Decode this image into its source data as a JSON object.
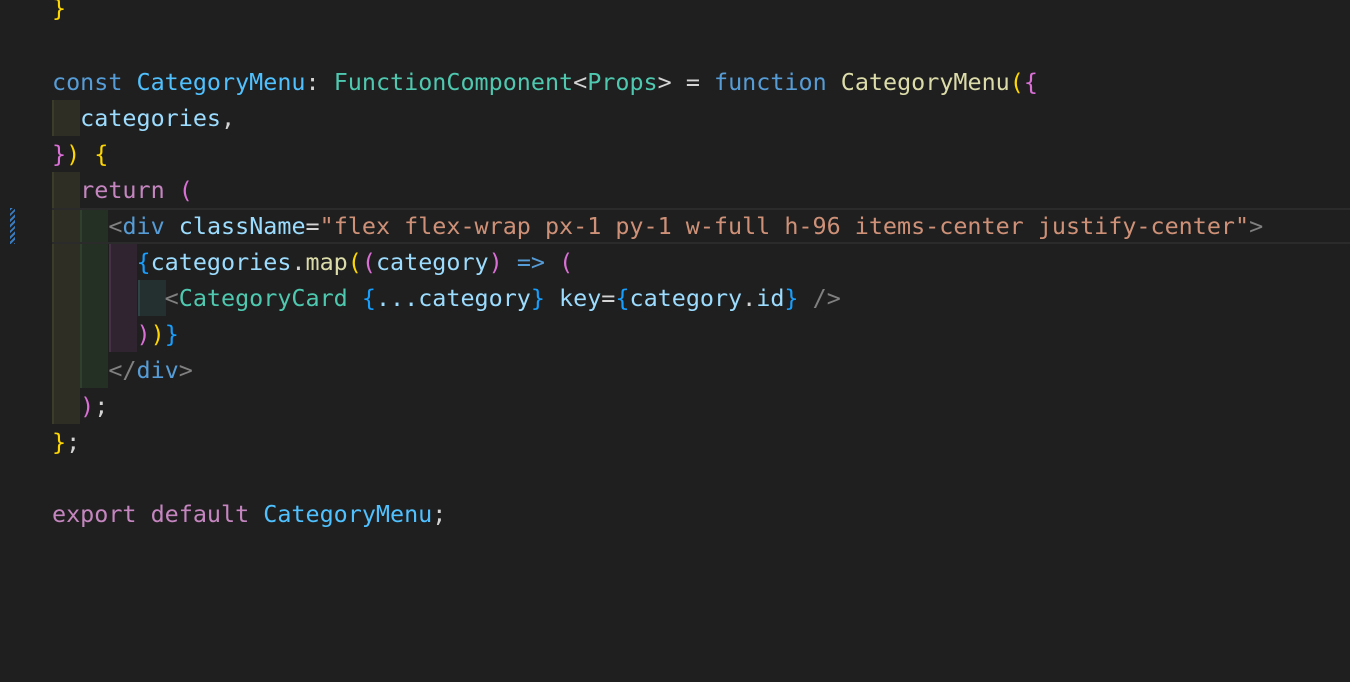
{
  "code": {
    "line0": {
      "brace": "}"
    },
    "line2": {
      "const_kw": "const",
      "name": "CategoryMenu",
      "colon": ":",
      "type": "FunctionComponent",
      "lt": "<",
      "props": "Props",
      "gt": ">",
      "eq": "=",
      "function_kw": "function",
      "fn_name": "CategoryMenu",
      "paren": "(",
      "brace": "{"
    },
    "line3": {
      "param": "categories",
      "comma": ","
    },
    "line4": {
      "brace_close": "}",
      "paren_close": ")",
      "brace_open": "{"
    },
    "line5": {
      "return_kw": "return",
      "paren": "("
    },
    "line6": {
      "lt": "<",
      "tag": "div",
      "attr": "className",
      "eq": "=",
      "value": "\"flex flex-wrap px-1 py-1 w-full h-96 items-center justify-center\"",
      "gt": ">"
    },
    "line7": {
      "brace": "{",
      "obj": "categories",
      "dot": ".",
      "method": "map",
      "paren1": "(",
      "paren2": "(",
      "arg": "category",
      "paren3": ")",
      "arrow": "=>",
      "paren4": "("
    },
    "line8": {
      "lt": "<",
      "component": "CategoryCard",
      "spread_open": "{",
      "spread": "...category",
      "spread_close": "}",
      "key_attr": "key",
      "eq": "=",
      "key_open": "{",
      "key_obj": "category",
      "key_dot": ".",
      "key_prop": "id",
      "key_close": "}",
      "self_close": "/>"
    },
    "line9": {
      "p1": ")",
      "p2": ")",
      "brace": "}"
    },
    "line10": {
      "open": "</",
      "tag": "div",
      "gt": ">"
    },
    "line11": {
      "paren": ")",
      "semi": ";"
    },
    "line12": {
      "brace": "}",
      "semi": ";"
    },
    "line14": {
      "export_kw": "export",
      "default_kw": "default",
      "name": "CategoryMenu",
      "semi": ";"
    }
  }
}
